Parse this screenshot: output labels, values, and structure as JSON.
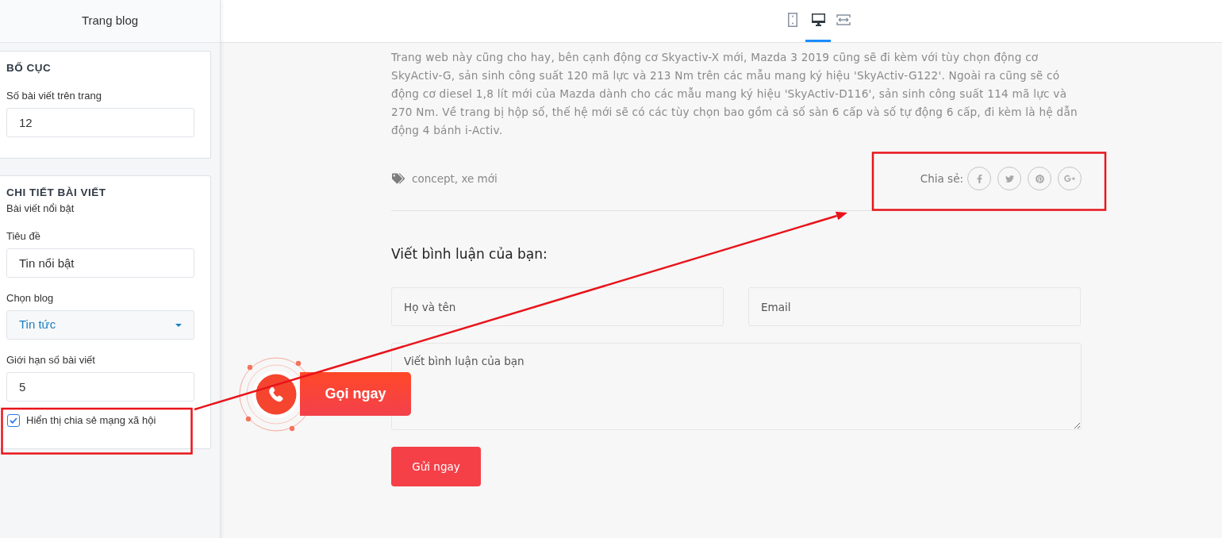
{
  "sidebar": {
    "title": "Trang blog",
    "sections": [
      {
        "heading": "BỐ CỤC",
        "fields": [
          {
            "kind": "input",
            "label": "Số bài viết trên trang",
            "value": "12"
          }
        ]
      },
      {
        "heading": "CHI TIẾT BÀI VIẾT",
        "subheading": "Bài viết nổi bật",
        "fields": [
          {
            "kind": "input",
            "label": "Tiêu đề",
            "value": "Tin nổi bật"
          },
          {
            "kind": "select",
            "label": "Chọn blog",
            "value": "Tin tức"
          },
          {
            "kind": "input",
            "label": "Giới hạn số bài viết",
            "value": "5"
          },
          {
            "kind": "checkbox",
            "label": "Hiển thị chia sẻ mạng xã hội",
            "checked": true
          }
        ]
      }
    ]
  },
  "toolbar": {
    "views": [
      {
        "kind": "tablet",
        "selected": false
      },
      {
        "kind": "desktop",
        "selected": true
      },
      {
        "kind": "fullwidth",
        "selected": false
      }
    ]
  },
  "article": {
    "body": "Trang web này cũng cho hay, bên cạnh động cơ Skyactiv-X mới, Mazda 3 2019 cũng sẽ đi kèm với tùy chọn động cơ SkyActiv-G, sản sinh công suất 120 mã lực và 213 Nm trên các mẫu mang ký hiệu 'SkyActiv-G122'. Ngoài ra cũng sẽ có động cơ diesel 1,8 lít mới của Mazda dành cho các mẫu mang ký hiệu 'SkyActiv-D116', sản sinh công suất 114 mã lực và 270 Nm. Về trang bị hộp số, thế hệ mới sẽ có các tùy chọn bao gồm cả số sàn 6 cấp và số tự động 6 cấp, đi kèm là hệ dẫn động 4 bánh i-Activ.",
    "tags": "concept, xe mới",
    "share": {
      "label": "Chia sẻ:",
      "networks": [
        {
          "kind": "facebook"
        },
        {
          "kind": "twitter"
        },
        {
          "kind": "pinterest"
        },
        {
          "kind": "googleplus"
        }
      ]
    }
  },
  "comment_form": {
    "heading": "Viết bình luận của bạn:",
    "name": {
      "placeholder": "Họ và tên"
    },
    "email": {
      "placeholder": "Email"
    },
    "message": {
      "placeholder": "Viết bình luận của bạn"
    },
    "submit": "Gửi ngay"
  },
  "call_button": {
    "label": "Gọi ngay"
  }
}
